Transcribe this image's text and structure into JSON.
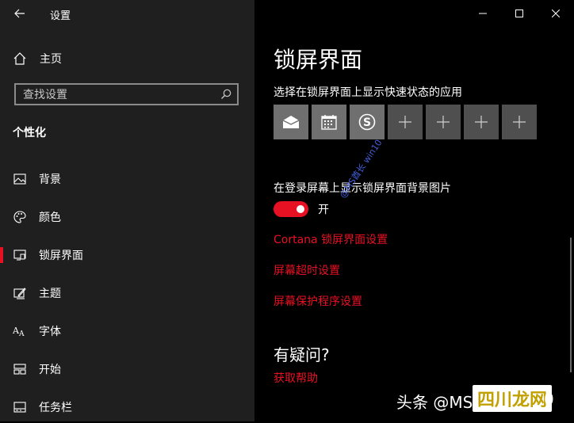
{
  "window": {
    "title": "设置"
  },
  "sidebar": {
    "home_label": "主页",
    "search_placeholder": "查找设置",
    "section_title": "个性化",
    "items": [
      {
        "label": "背景",
        "icon": "image-icon"
      },
      {
        "label": "颜色",
        "icon": "palette-icon"
      },
      {
        "label": "锁屏界面",
        "icon": "lock-screen-icon",
        "active": true
      },
      {
        "label": "主题",
        "icon": "theme-icon"
      },
      {
        "label": "字体",
        "icon": "font-icon"
      },
      {
        "label": "开始",
        "icon": "start-icon"
      },
      {
        "label": "任务栏",
        "icon": "taskbar-icon"
      }
    ]
  },
  "main": {
    "title": "锁屏界面",
    "quick_status_title": "选择在锁屏界面上显示快速状态的应用",
    "quick_tiles": [
      {
        "icon": "mail-icon"
      },
      {
        "icon": "calendar-icon"
      },
      {
        "icon": "skype-icon"
      },
      {
        "icon": "add-icon"
      },
      {
        "icon": "add-icon"
      },
      {
        "icon": "add-icon"
      },
      {
        "icon": "add-icon"
      }
    ],
    "show_bg_title": "在登录屏幕上显示锁屏界面背景图片",
    "toggle_state": "开",
    "links": {
      "cortana": "Cortana 锁屏界面设置",
      "timeout": "屏幕超时设置",
      "screensaver": "屏幕保护程序设置"
    },
    "faq_title": "有疑问?",
    "help_link": "获取帮助"
  },
  "overlay": {
    "watermark_diag": "@MS酋长 win10",
    "watermark_bottom": "头条 @MS",
    "stamp": "四川龙网",
    "suffix": "0"
  },
  "colors": {
    "accent": "#e81123",
    "sidebar_bg": "#1f1f1f",
    "main_bg": "#000000"
  }
}
